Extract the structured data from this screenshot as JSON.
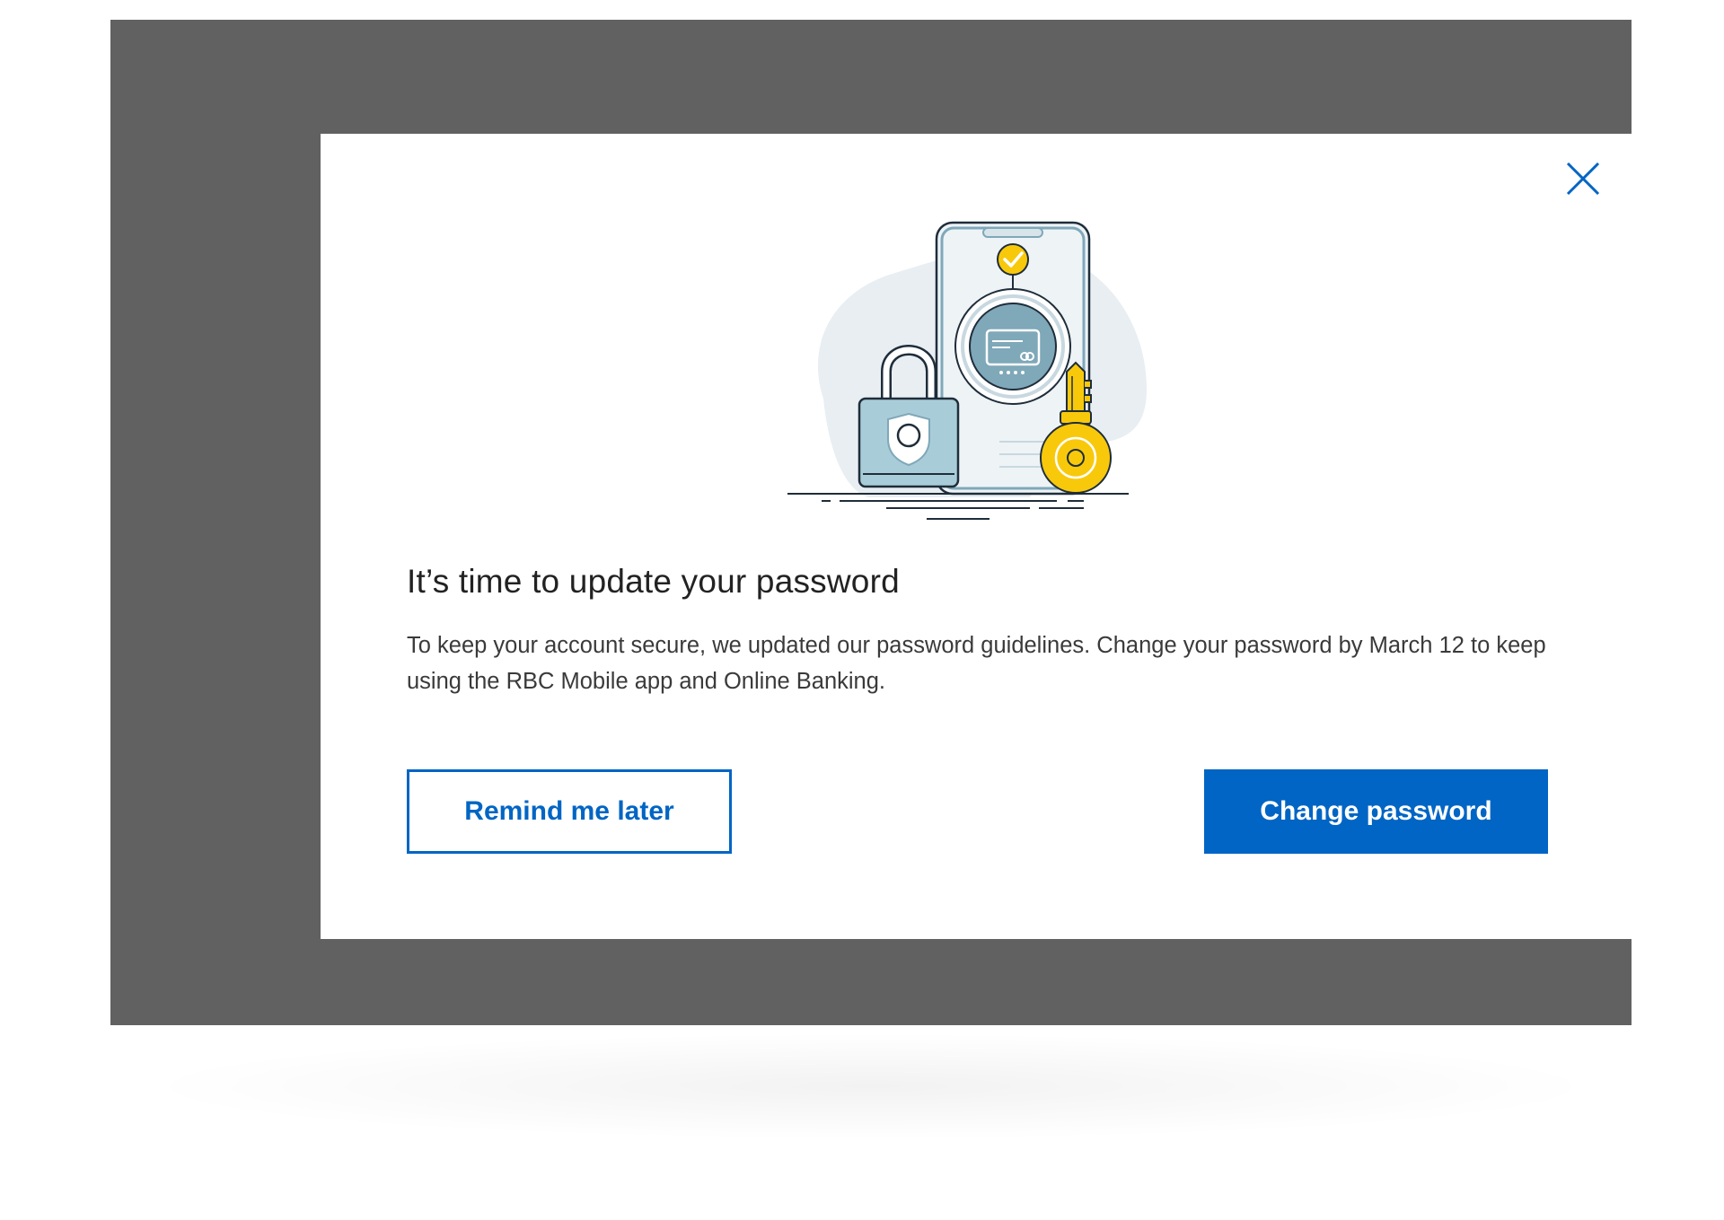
{
  "dialog": {
    "title": "It’s time to update your password",
    "body": "To keep your account secure, we updated our password guidelines. Change your password by March 12 to keep using the RBC Mobile app and Online Banking.",
    "close_icon": "close-icon",
    "illustration_icon": "phone-lock-key-illustration"
  },
  "actions": {
    "remind_label": "Remind me later",
    "change_label": "Change password"
  },
  "colors": {
    "accent": "#0065c4",
    "overlay": "#616161",
    "illustration_yellow": "#f8c90b",
    "illustration_teal": "#7fa8b9",
    "illustration_bg": "#e8eef2"
  }
}
